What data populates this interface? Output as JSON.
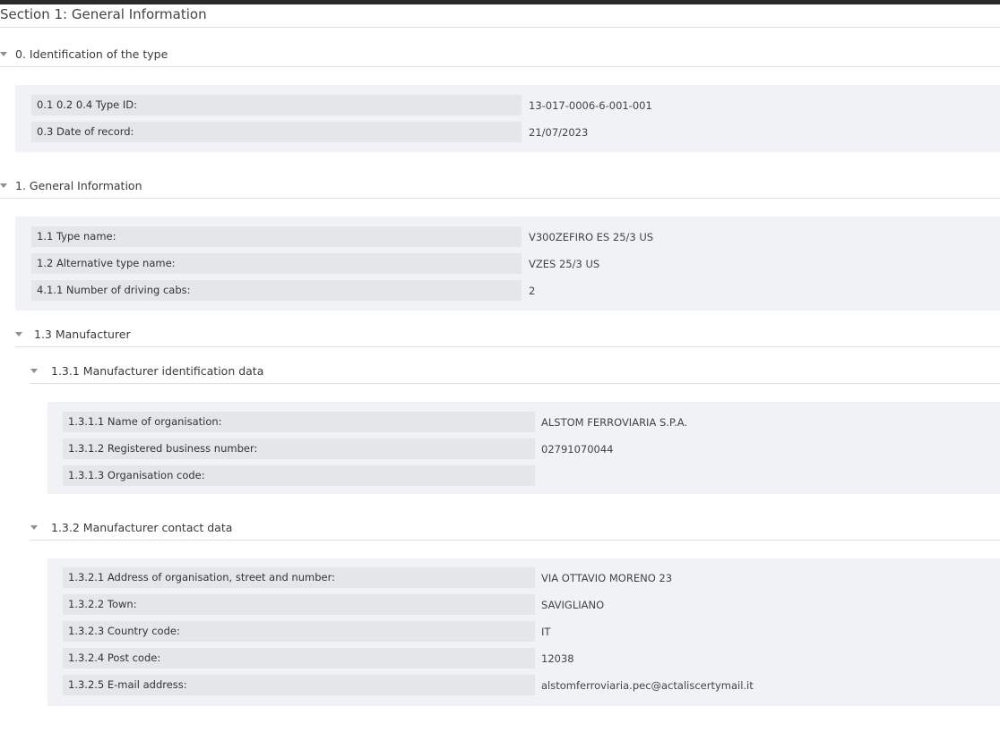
{
  "section": {
    "title": "Section 1: General Information"
  },
  "group0": {
    "title": "0. Identification of the type",
    "rows": [
      {
        "label": "0.1 0.2 0.4 Type ID:",
        "value": "13-017-0006-6-001-001"
      },
      {
        "label": "0.3 Date of record:",
        "value": "21/07/2023"
      }
    ]
  },
  "group1": {
    "title": "1. General Information",
    "rows": [
      {
        "label": "1.1 Type name:",
        "value": "V300ZEFIRO ES 25/3 US"
      },
      {
        "label": "1.2 Alternative type name:",
        "value": "VZES 25/3 US"
      },
      {
        "label": "4.1.1 Number of driving cabs:",
        "value": "2"
      }
    ]
  },
  "manufacturer": {
    "title": "1.3 Manufacturer",
    "identification": {
      "title": "1.3.1 Manufacturer identification data",
      "rows": [
        {
          "label": "1.3.1.1 Name of organisation:",
          "value": "ALSTOM FERROVIARIA S.P.A."
        },
        {
          "label": "1.3.1.2 Registered business number:",
          "value": "02791070044"
        },
        {
          "label": "1.3.1.3 Organisation code:",
          "value": ""
        }
      ]
    },
    "contact": {
      "title": "1.3.2 Manufacturer contact data",
      "rows": [
        {
          "label": "1.3.2.1 Address of organisation, street and number:",
          "value": "VIA OTTAVIO MORENO 23"
        },
        {
          "label": "1.3.2.2 Town:",
          "value": "SAVIGLIANO"
        },
        {
          "label": "1.3.2.3 Country code:",
          "value": "IT"
        },
        {
          "label": "1.3.2.4 Post code:",
          "value": "12038"
        },
        {
          "label": "1.3.2.5 E-mail address:",
          "value": "alstomferroviaria.pec@actaliscertymail.it"
        }
      ]
    }
  }
}
